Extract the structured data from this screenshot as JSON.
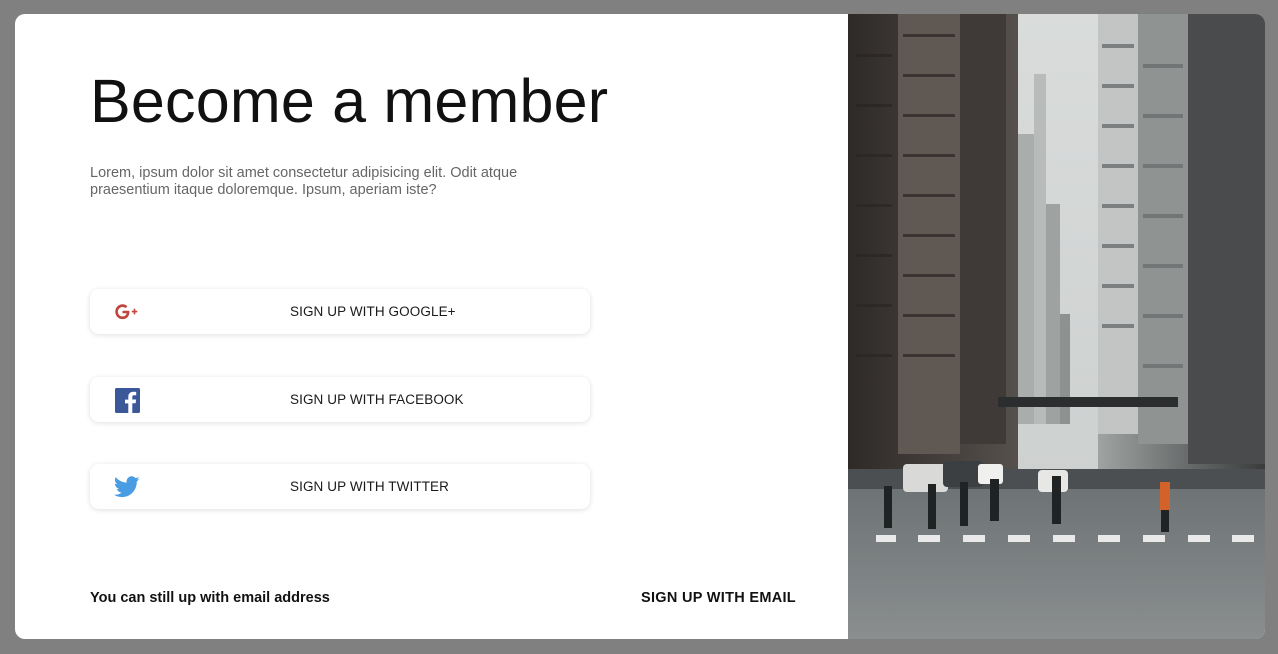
{
  "signup": {
    "title": "Become a member",
    "description": "Lorem, ipsum dolor sit amet consectetur adipisicing elit. Odit atque praesentium itaque doloremque. Ipsum, aperiam iste?",
    "buttons": [
      {
        "label": "SIGN UP WITH GOOGLE+",
        "icon": "google-plus-icon",
        "color": "#c0453a"
      },
      {
        "label": "SIGN UP WITH FACEBOOK",
        "icon": "facebook-icon",
        "color": "#3b5998"
      },
      {
        "label": "SIGN UP WITH TWITTER",
        "icon": "twitter-icon",
        "color": "#4a9de3"
      }
    ],
    "footer_text": "You can still up with email address",
    "email_link": "SIGN UP WITH EMAIL"
  },
  "hero_image": {
    "subject": "city street photo"
  }
}
